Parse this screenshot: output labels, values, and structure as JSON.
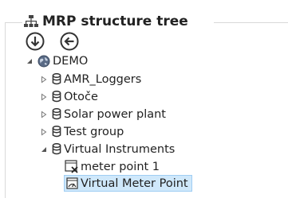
{
  "panel": {
    "title": "MRP structure tree",
    "title_icon": "hierarchy-tree-icon"
  },
  "toolbar": {
    "expand_icon": "arrow-down-circle-icon",
    "back_icon": "arrow-left-circle-icon"
  },
  "tree": {
    "root": {
      "label": "DEMO",
      "icon": "globe-icon",
      "expanded": true
    },
    "groups": [
      {
        "label": "AMR_Loggers",
        "icon": "group-icon",
        "expanded": false
      },
      {
        "label": "Otoče",
        "icon": "group-icon",
        "expanded": false
      },
      {
        "label": "Solar power plant",
        "icon": "group-icon",
        "expanded": false
      },
      {
        "label": "Test group",
        "icon": "group-icon",
        "expanded": false
      },
      {
        "label": "Virtual Instruments",
        "icon": "group-icon",
        "expanded": true
      }
    ],
    "leaves": [
      {
        "label": "meter point 1",
        "icon": "meter-point-icon",
        "selected": false
      },
      {
        "label": "Virtual Meter Point",
        "icon": "virtual-meter-icon",
        "selected": true
      }
    ]
  },
  "colors": {
    "selection_bg": "#cfe8fb",
    "selection_border": "#9fcdf3",
    "text": "#222222"
  }
}
